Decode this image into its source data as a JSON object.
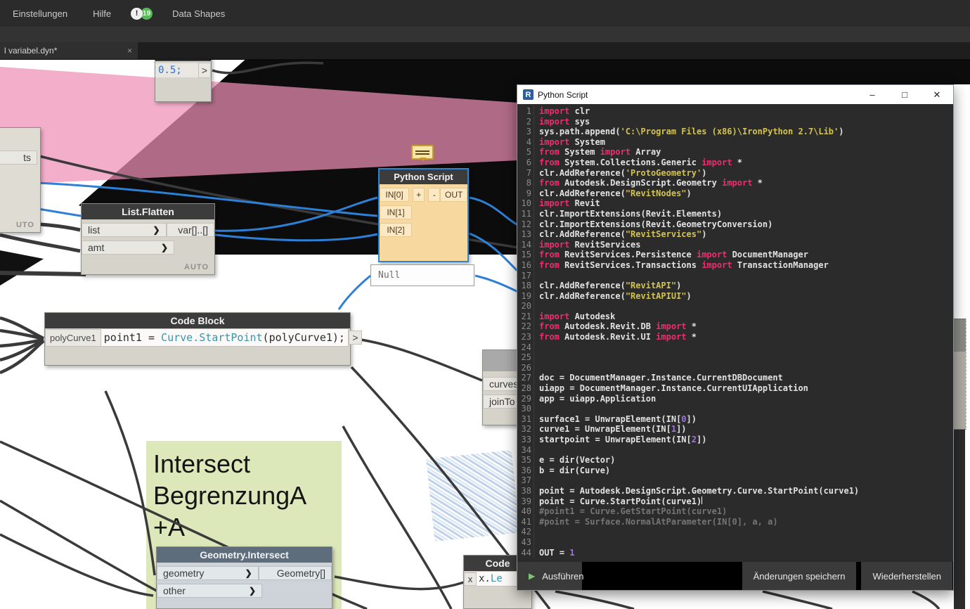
{
  "menu": {
    "items": [
      "Einstellungen",
      "Hilfe",
      "Data Shapes"
    ],
    "alert_glyph": "!",
    "badge_count": "19"
  },
  "tab": {
    "label": "l variabel.dyn*",
    "close_glyph": "×"
  },
  "canvas": {
    "left_partial": {
      "output": "ts",
      "footer": "UTO"
    },
    "code_block_small": {
      "code": "0.5;",
      "out": ">"
    },
    "list_flatten": {
      "title": "List.Flatten",
      "inputs": [
        "list",
        "amt"
      ],
      "chevron": "❯",
      "output": "var[]..[]",
      "footer": "AUTO"
    },
    "python_node": {
      "title": "Python Script",
      "inputs": [
        "IN[0]",
        "IN[1]",
        "IN[2]"
      ],
      "plus": "+",
      "minus": "-",
      "output": "OUT"
    },
    "preview_value": "Null",
    "code_block_big": {
      "title": "Code Block",
      "input": "polyCurve1",
      "seg_plain1": "point1 = ",
      "seg_accent": "Curve.StartPoint",
      "seg_plain2": "(polyCurve1);",
      "out": ">"
    },
    "curves_node": {
      "inputs": [
        "curves",
        "joinTo"
      ]
    },
    "group": {
      "lines": [
        "Intersect",
        "BegrenzungA",
        "+A"
      ]
    },
    "geometry_intersect": {
      "title": "Geometry.Intersect",
      "inputs": [
        "geometry",
        "other"
      ],
      "chevron": "❯",
      "output": "Geometry[]"
    },
    "code_node": {
      "title": "Code",
      "input": "x",
      "seg_plain": "x.",
      "seg_accent": "Le"
    }
  },
  "editor": {
    "title": "Python Script",
    "win_min": "–",
    "win_max": "□",
    "win_close": "✕",
    "buttons": {
      "run": "Ausführen",
      "run_glyph": "▶",
      "save": "Änderungen speichern",
      "revert": "Wiederherstellen"
    },
    "lines": [
      [
        [
          "kw",
          "import"
        ],
        [
          "id",
          " clr"
        ]
      ],
      [
        [
          "kw",
          "import"
        ],
        [
          "id",
          " sys"
        ]
      ],
      [
        [
          "id",
          "sys.path.append("
        ],
        [
          "str",
          "'C:\\Program Files (x86)\\IronPython 2.7\\Lib'"
        ],
        [
          "id",
          ")"
        ]
      ],
      [
        [
          "kw",
          "import"
        ],
        [
          "id",
          " System"
        ]
      ],
      [
        [
          "kw",
          "from"
        ],
        [
          "id",
          " System "
        ],
        [
          "kw",
          "import"
        ],
        [
          "id",
          " Array"
        ]
      ],
      [
        [
          "kw",
          "from"
        ],
        [
          "id",
          " System.Collections.Generic "
        ],
        [
          "kw",
          "import"
        ],
        [
          "id",
          " *"
        ]
      ],
      [
        [
          "id",
          "clr.AddReference("
        ],
        [
          "str",
          "'ProtoGeometry'"
        ],
        [
          "id",
          ")"
        ]
      ],
      [
        [
          "kw",
          "from"
        ],
        [
          "id",
          " Autodesk.DesignScript.Geometry "
        ],
        [
          "kw",
          "import"
        ],
        [
          "id",
          " *"
        ]
      ],
      [
        [
          "id",
          "clr.AddReference("
        ],
        [
          "str",
          "\"RevitNodes\""
        ],
        [
          "id",
          ")"
        ]
      ],
      [
        [
          "kw",
          "import"
        ],
        [
          "id",
          " Revit"
        ]
      ],
      [
        [
          "id",
          "clr.ImportExtensions(Revit.Elements)"
        ]
      ],
      [
        [
          "id",
          "clr.ImportExtensions(Revit.GeometryConversion)"
        ]
      ],
      [
        [
          "id",
          "clr.AddReference("
        ],
        [
          "str",
          "\"RevitServices\""
        ],
        [
          "id",
          ")"
        ]
      ],
      [
        [
          "kw",
          "import"
        ],
        [
          "id",
          " RevitServices"
        ]
      ],
      [
        [
          "kw",
          "from"
        ],
        [
          "id",
          " RevitServices.Persistence "
        ],
        [
          "kw",
          "import"
        ],
        [
          "id",
          " DocumentManager"
        ]
      ],
      [
        [
          "kw",
          "from"
        ],
        [
          "id",
          " RevitServices.Transactions "
        ],
        [
          "kw",
          "import"
        ],
        [
          "id",
          " TransactionManager"
        ]
      ],
      [],
      [
        [
          "id",
          "clr.AddReference("
        ],
        [
          "str",
          "\"RevitAPI\""
        ],
        [
          "id",
          ")"
        ]
      ],
      [
        [
          "id",
          "clr.AddReference("
        ],
        [
          "str",
          "\"RevitAPIUI\""
        ],
        [
          "id",
          ")"
        ]
      ],
      [],
      [
        [
          "kw",
          "import"
        ],
        [
          "id",
          " Autodesk"
        ]
      ],
      [
        [
          "kw",
          "from"
        ],
        [
          "id",
          " Autodesk.Revit.DB "
        ],
        [
          "kw",
          "import"
        ],
        [
          "id",
          " *"
        ]
      ],
      [
        [
          "kw",
          "from"
        ],
        [
          "id",
          " Autodesk.Revit.UI "
        ],
        [
          "kw",
          "import"
        ],
        [
          "id",
          " *"
        ]
      ],
      [],
      [],
      [],
      [
        [
          "id",
          "doc = DocumentManager.Instance.CurrentDBDocument"
        ]
      ],
      [
        [
          "id",
          "uiapp = DocumentManager.Instance.CurrentUIApplication"
        ]
      ],
      [
        [
          "id",
          "app = uiapp.Application"
        ]
      ],
      [],
      [
        [
          "id",
          "surface1 = UnwrapElement(IN["
        ],
        [
          "num",
          "0"
        ],
        [
          "id",
          "])"
        ]
      ],
      [
        [
          "id",
          "curve1 = UnwrapElement(IN["
        ],
        [
          "num",
          "1"
        ],
        [
          "id",
          "])"
        ]
      ],
      [
        [
          "id",
          "startpoint = UnwrapElement(IN["
        ],
        [
          "num",
          "2"
        ],
        [
          "id",
          "])"
        ]
      ],
      [],
      [
        [
          "id",
          "e = dir(Vector)"
        ]
      ],
      [
        [
          "id",
          "b = dir(Curve)"
        ]
      ],
      [],
      [
        [
          "id",
          "point = Autodesk.DesignScript.Geometry.Curve.StartPoint(curve1)"
        ]
      ],
      [
        [
          "id",
          "point = Curve.StartPoint(curve1)"
        ],
        [
          "caret",
          ""
        ]
      ],
      [
        [
          "com",
          "#point1 = Curve.GetStartPoint(curve1)"
        ]
      ],
      [
        [
          "com",
          "#point = Surface.NormalAtParameter(IN[0], a, a)"
        ]
      ],
      [],
      [],
      [
        [
          "id",
          "OUT = "
        ],
        [
          "num",
          "1"
        ]
      ]
    ]
  },
  "colors": {
    "keyword_pink": "#ec2f6e",
    "string_yellow": "#d3c254",
    "number_purple": "#9d76d9",
    "comment_gray": "#757575",
    "editor_bg": "#2b2b2b",
    "selection_blue": "#2e86d2",
    "python_node_orange": "#f7d9a0",
    "group_green": "#dde8ba",
    "canvas_pink": "#f2b0ca",
    "wire_dark": "#3a3a3a",
    "wire_blue": "#2e7fd6",
    "run_green": "#7cc576"
  }
}
